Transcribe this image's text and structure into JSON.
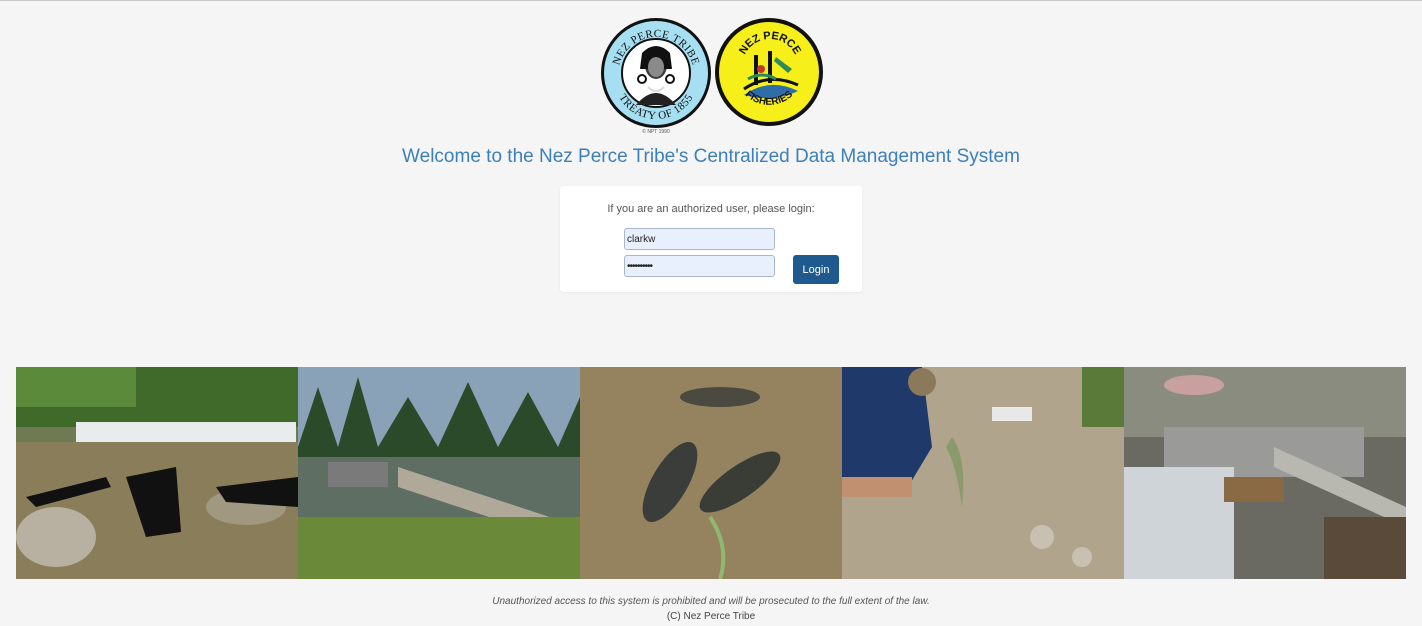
{
  "logos": {
    "tribe": {
      "top_text": "NEZ PERCE TRIBE",
      "bottom_text": "TREATY OF 1855",
      "small_text": "© NPT 1990"
    },
    "fisheries": {
      "top_text": "NEZ PERCE",
      "bottom_text": "FISHERIES"
    }
  },
  "welcome_title": "Welcome to the Nez Perce Tribe's Centralized Data Management System",
  "login": {
    "prompt": "If you are an authorized user, please login:",
    "username": "clarkw",
    "password": "••••••••••",
    "button_label": "Login"
  },
  "photos": [
    {
      "icon": "snorkelers-in-stream-photo"
    },
    {
      "icon": "fish-weir-river-photo"
    },
    {
      "icon": "salmon-underwater-photo"
    },
    {
      "icon": "fish-sampling-photo"
    },
    {
      "icon": "weir-trap-photo"
    }
  ],
  "footer": {
    "warning": "Unauthorized access to this system is prohibited and will be prosecuted to the full extent of the law.",
    "copyright": "(C) Nez Perce Tribe"
  },
  "colors": {
    "page_bg": "#f5f5f5",
    "title_blue": "#3d7fb8",
    "button_blue": "#1f5a8e",
    "input_bg": "#e8f0fe",
    "tribe_logo_blue": "#9fdcf0",
    "fisheries_logo_yellow": "#f6ef1a"
  }
}
